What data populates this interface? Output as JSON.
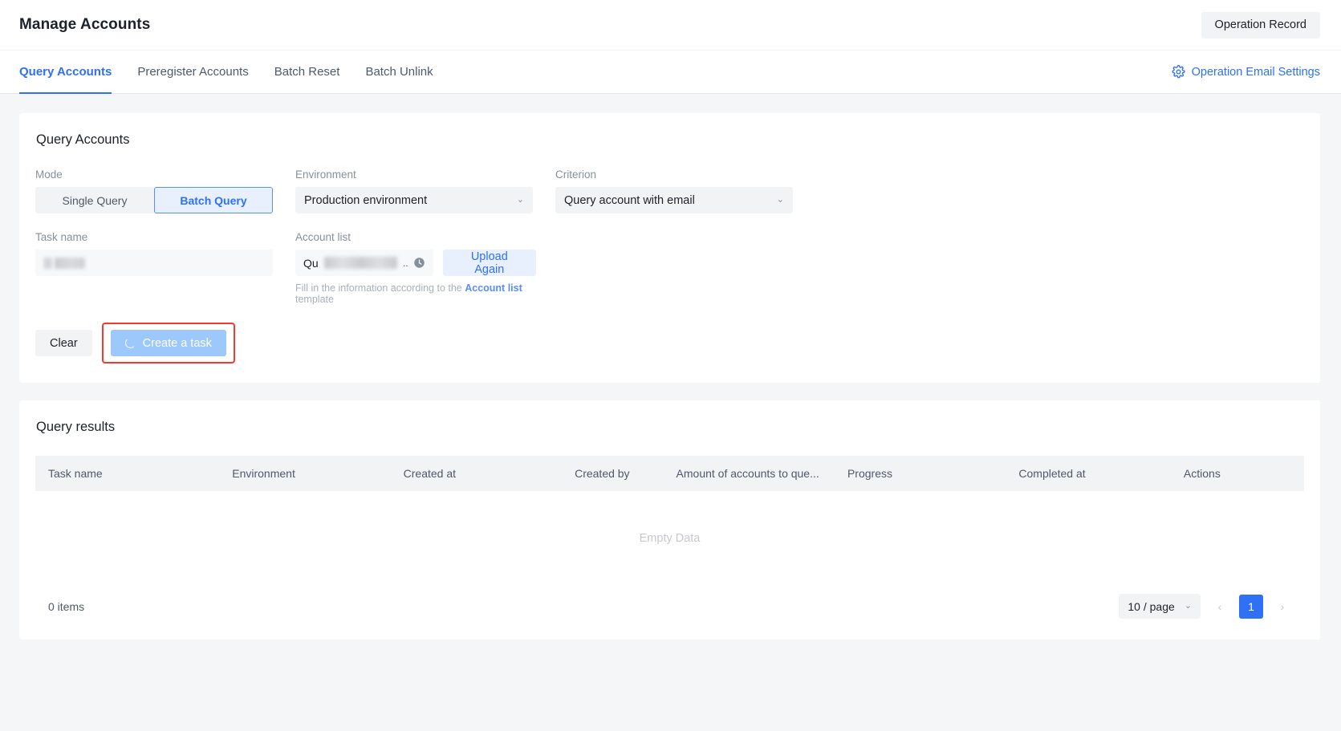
{
  "header": {
    "title": "Manage Accounts",
    "operation_record_label": "Operation Record"
  },
  "tabbar": {
    "tabs": [
      {
        "label": "Query Accounts",
        "active": true
      },
      {
        "label": "Preregister Accounts",
        "active": false
      },
      {
        "label": "Batch Reset",
        "active": false
      },
      {
        "label": "Batch Unlink",
        "active": false
      }
    ],
    "email_settings_label": "Operation Email Settings",
    "gear_icon": "gear-icon"
  },
  "query_form": {
    "title": "Query Accounts",
    "mode": {
      "label": "Mode",
      "options": [
        "Single Query",
        "Batch Query"
      ],
      "selected": "Batch Query"
    },
    "environment": {
      "label": "Environment",
      "value": "Production environment",
      "chevron": "⌄"
    },
    "criterion": {
      "label": "Criterion",
      "value": "Query account with email",
      "chevron": "⌄"
    },
    "task_name": {
      "label": "Task name",
      "value": "",
      "placeholder": "",
      "redacted": true
    },
    "account_list": {
      "label": "Account list",
      "file_name_prefix": "Qu",
      "file_name_suffix": "..",
      "status_icon": "clock-icon",
      "upload_again_label": "Upload Again",
      "help_prefix": "Fill in the information according to the ",
      "help_link": "Account list",
      "help_suffix": " template"
    },
    "buttons": {
      "clear_label": "Clear",
      "create_task_label": "Create a task",
      "create_task_loading": true,
      "highlight_color": "#f5392c"
    }
  },
  "results": {
    "title": "Query results",
    "columns": [
      "Task name",
      "Environment",
      "Created at",
      "Created by",
      "Amount of accounts to que...",
      "Progress",
      "Completed at",
      "Actions"
    ],
    "rows": [],
    "empty_text": "Empty Data",
    "footer": {
      "items_count": "0 items",
      "page_size": "10 / page",
      "page_size_chevron": "⌄",
      "prev_arrow": "‹",
      "next_arrow": "›",
      "current_page": "1"
    }
  },
  "theme": {
    "accent": "#2f70f5",
    "accent_light": "#e8f0fe",
    "page_bg": "#f5f6f7",
    "card_bg": "#ffffff",
    "muted_text": "#86909c"
  }
}
